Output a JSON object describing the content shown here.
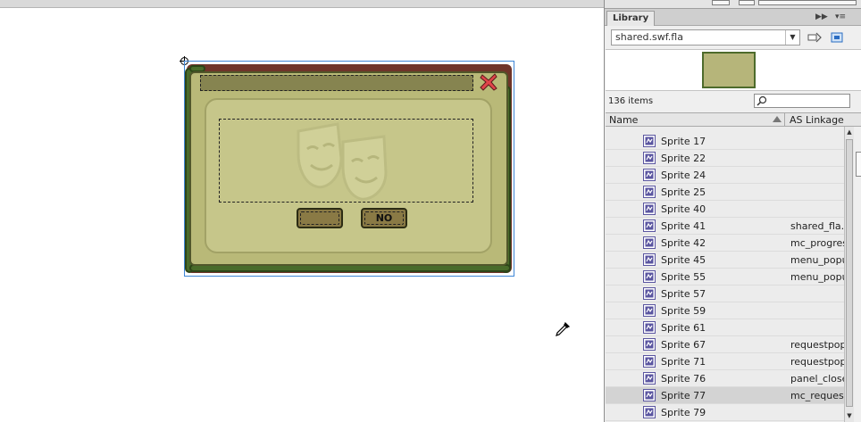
{
  "library": {
    "tab_label": "Library",
    "document": "shared.swf.fla",
    "items_count": "136 items",
    "search_placeholder": "",
    "columns": {
      "name": "Name",
      "linkage": "AS Linkage"
    },
    "rows": [
      {
        "name": "Sprite 17",
        "linkage": ""
      },
      {
        "name": "Sprite 22",
        "linkage": ""
      },
      {
        "name": "Sprite 24",
        "linkage": ""
      },
      {
        "name": "Sprite 25",
        "linkage": ""
      },
      {
        "name": "Sprite 40",
        "linkage": ""
      },
      {
        "name": "Sprite 41",
        "linkage": "shared_fla."
      },
      {
        "name": "Sprite 42",
        "linkage": "mc_progres"
      },
      {
        "name": "Sprite 45",
        "linkage": "menu_popu"
      },
      {
        "name": "Sprite 55",
        "linkage": "menu_popu"
      },
      {
        "name": "Sprite 57",
        "linkage": ""
      },
      {
        "name": "Sprite 59",
        "linkage": ""
      },
      {
        "name": "Sprite 61",
        "linkage": ""
      },
      {
        "name": "Sprite 67",
        "linkage": "requestpop"
      },
      {
        "name": "Sprite 71",
        "linkage": "requestpop"
      },
      {
        "name": "Sprite 76",
        "linkage": "panel_close"
      },
      {
        "name": "Sprite 77",
        "linkage": "mc_request",
        "selected": true
      },
      {
        "name": "Sprite 79",
        "linkage": ""
      }
    ]
  },
  "stage": {
    "popup": {
      "yes_label": "",
      "no_label": "NO"
    }
  },
  "colors": {
    "panel_face": "#b9b978",
    "panel_border": "#6f3429",
    "vine": "#496b2a",
    "close_red": "#e0444a",
    "selection_blue": "#3e86d6",
    "symbol_icon": "#5a55a0"
  },
  "icons": [
    "registration-point-icon",
    "close-x-icon",
    "theater-masks-icon",
    "eyedropper-icon",
    "pin-icon",
    "new-library-icon",
    "search-icon",
    "movieclip-symbol-icon"
  ]
}
